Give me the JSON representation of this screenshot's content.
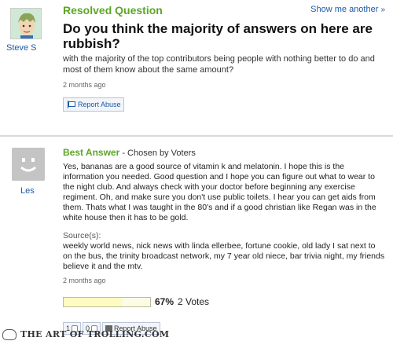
{
  "question": {
    "status": "Resolved Question",
    "show_more": "Show me another",
    "title": "Do you think the majority of answers on here are rubbish?",
    "body": "with the majority of the top contributors being people with nothing better to do and most of them know about the same amount?",
    "time": "2 months ago",
    "report_label": "Report Abuse",
    "user": "Steve S"
  },
  "answer": {
    "user": "Les",
    "label": "Best Answer",
    "chosen_by": "- Chosen by Voters",
    "body": "Yes, bananas are a good source of vitamin k and melatonin. I hope this is the information you needed. Good question and I hope you can figure out what to wear to the night club. And always check with your doctor before beginning any exercise regiment. Oh, and make sure you don't use public toilets. I hear you can get aids from them. Thats what I was taught in the 80's and if a good christian like Regan was in the white house then it has to be gold.",
    "sources_label": "Source(s):",
    "sources": "weekly world news, nick news with linda ellerbee, fortune cookie, old lady I sat next to on the bus, the trinity broadcast network, my 7 year old niece, bar trivia night, my friends believe it and the mtv.",
    "time": "2 months ago",
    "vote_percent": "67%",
    "vote_fraction": 0.67,
    "votes": "2 Votes",
    "thumbs_up": "1",
    "thumbs_down": "0",
    "report_label": "Report Abuse"
  },
  "watermark": "THE ART OF TROLLING.COM",
  "colors": {
    "accent_green": "#5ca626",
    "link_blue": "#1c5aa8"
  }
}
